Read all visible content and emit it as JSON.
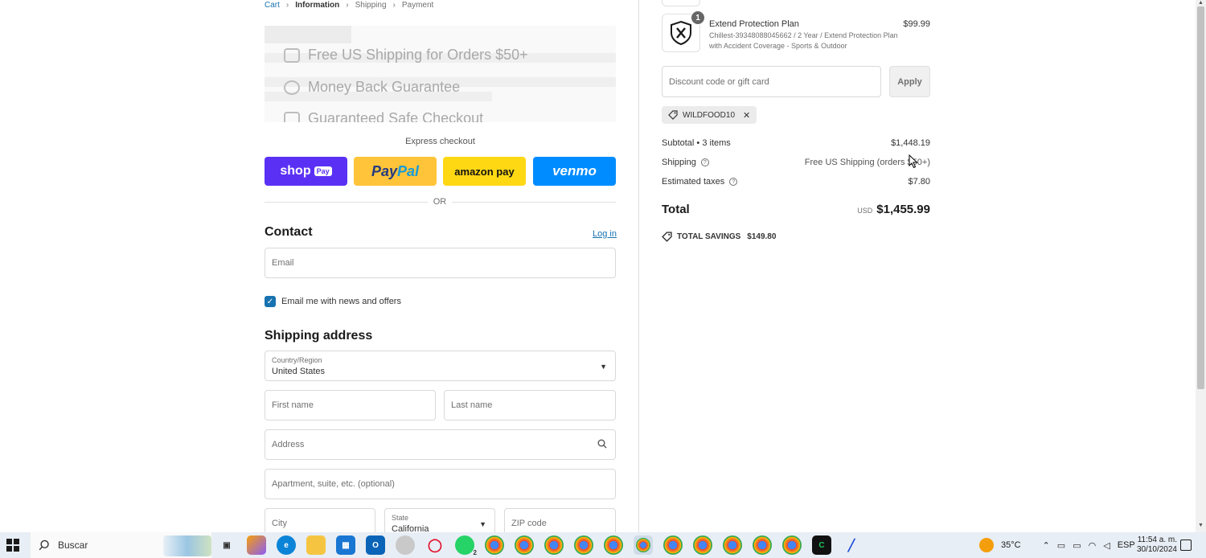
{
  "breadcrumb": {
    "cart": "Cart",
    "information": "Information",
    "shipping": "Shipping",
    "payment": "Payment"
  },
  "banner": {
    "free_shipping": "Free US Shipping for Orders $50+",
    "money_back": "Money Back Guarantee",
    "safe_checkout": "Guaranteed Safe Checkout"
  },
  "express": {
    "title": "Express checkout",
    "shop_pay": "shop",
    "shop_pay_tag": "Pay",
    "paypal_a": "Pay",
    "paypal_b": "Pal",
    "amazon_pay": "amazon pay",
    "venmo": "venmo",
    "or": "OR"
  },
  "contact": {
    "title": "Contact",
    "login": "Log in",
    "email_placeholder": "Email",
    "newsletter_label": "Email me with news and offers",
    "newsletter_checked": true
  },
  "shipping_address": {
    "title": "Shipping address",
    "country_label": "Country/Region",
    "country_value": "United States",
    "first_name_placeholder": "First name",
    "last_name_placeholder": "Last name",
    "address_placeholder": "Address",
    "apartment_placeholder": "Apartment, suite, etc. (optional)",
    "city_placeholder": "City",
    "state_label": "State",
    "state_value": "California",
    "zip_placeholder": "ZIP code"
  },
  "order": {
    "item": {
      "quantity": "1",
      "name": "Extend Protection Plan",
      "description": "Chillest-39348088045662 / 2 Year / Extend Protection Plan with Accident Coverage - Sports & Outdoor",
      "price": "$99.99"
    },
    "discount_placeholder": "Discount code or gift card",
    "apply_label": "Apply",
    "applied_code": "WILDFOOD10",
    "subtotal_label": "Subtotal • 3 items",
    "subtotal_value": "$1,448.19",
    "shipping_label": "Shipping",
    "shipping_value": "Free US Shipping (orders $50+)",
    "taxes_label": "Estimated taxes",
    "taxes_value": "$7.80",
    "total_label": "Total",
    "total_currency": "USD",
    "total_value": "$1,455.99",
    "savings_label": "TOTAL SAVINGS",
    "savings_value": "$149.80"
  },
  "taskbar": {
    "search_label": "Buscar",
    "temperature": "35°C",
    "language": "ESP",
    "time": "11:54 a. m.",
    "date": "30/10/2024",
    "whatsapp_badge": "2"
  },
  "colors": {
    "accent": "#1773b0",
    "shop_pay": "#5a31f4",
    "paypal": "#ffc439",
    "amazon": "#ffd814",
    "venmo": "#008cff"
  }
}
